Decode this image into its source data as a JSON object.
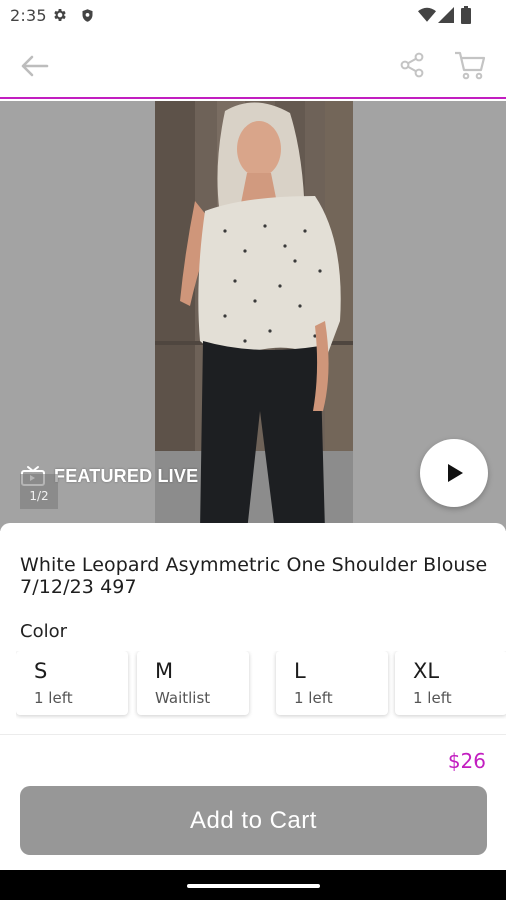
{
  "status_bar": {
    "time": "2:35",
    "icons": [
      "gear-icon",
      "shield-icon",
      "wifi-icon",
      "signal-icon",
      "battery-icon"
    ]
  },
  "app_bar": {
    "back_icon": "arrow-left-icon",
    "share_icon": "share-icon",
    "cart_icon": "cart-icon",
    "accent_color": "#c21ec0"
  },
  "media": {
    "featured_label": "FEATURED LIVE",
    "featured_icon": "tv-icon",
    "page_indicator": "1/2",
    "play_icon": "play-icon",
    "background_color": "#a3a3a3"
  },
  "product": {
    "title": "White Leopard Asymmetric One Shoulder Blouse 7/12/23 497",
    "color_label": "Color",
    "sizes": [
      {
        "name": "S",
        "stock": "1 left"
      },
      {
        "name": "M",
        "stock": "Waitlist"
      },
      {
        "name": "L",
        "stock": "1 left"
      },
      {
        "name": "XL",
        "stock": "1 left"
      }
    ],
    "price": "$26",
    "price_color": "#c21ec0",
    "add_to_cart_label": "Add to Cart",
    "button_color": "#979797"
  }
}
